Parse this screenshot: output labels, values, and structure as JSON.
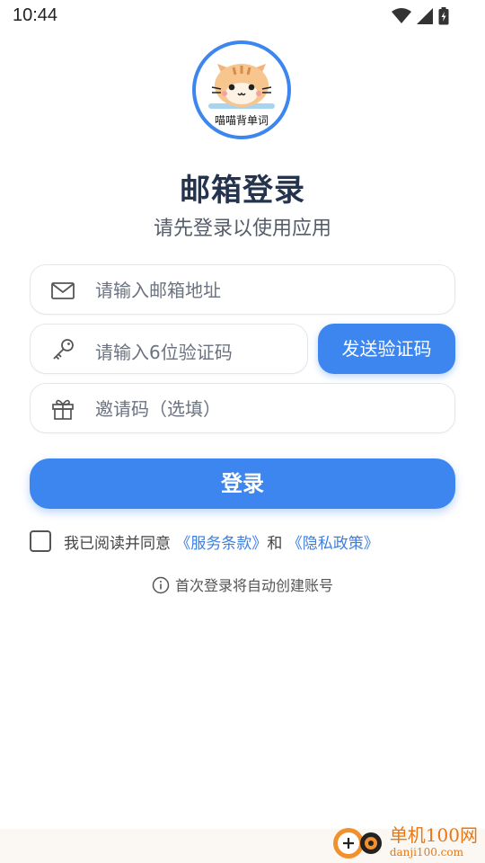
{
  "status_bar": {
    "time": "10:44"
  },
  "logo": {
    "caption": "喵喵背单词"
  },
  "header": {
    "title": "邮箱登录",
    "subtitle": "请先登录以使用应用"
  },
  "form": {
    "email_placeholder": "请输入邮箱地址",
    "code_placeholder": "请输入6位验证码",
    "send_code_label": "发送验证码",
    "invite_placeholder": "邀请码（选填）",
    "login_label": "登录"
  },
  "agreement": {
    "prefix": "我已阅读并同意 ",
    "terms_link": "《服务条款》",
    "conjunction": "和",
    "privacy_link": " 《隐私政策》",
    "checked": false
  },
  "notice": {
    "text": "首次登录将自动创建账号"
  },
  "watermark": {
    "site_cn": "单机100网",
    "site_en": "danji100.com"
  },
  "colors": {
    "accent": "#3d86f0",
    "title": "#24344f",
    "link": "#3d7fe0",
    "watermark": "#e77716"
  },
  "icons": [
    "wifi-icon",
    "signal-icon",
    "battery-icon",
    "mail-icon",
    "key-icon",
    "gift-icon",
    "info-icon"
  ]
}
